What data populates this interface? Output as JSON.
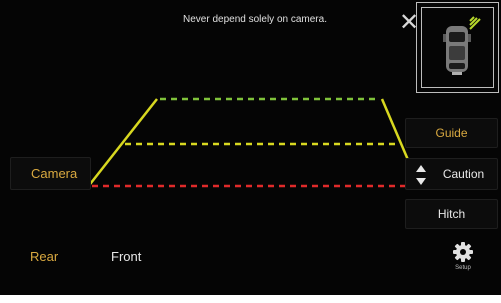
{
  "warning_text": "Never depend solely on camera.",
  "close_symbol": "✕",
  "left_buttons": {
    "camera_label": "Camera"
  },
  "right_buttons": {
    "guide_label": "Guide",
    "caution_label": "Caution",
    "hitch_label": "Hitch"
  },
  "tabs": {
    "rear_label": "Rear",
    "front_label": "Front"
  },
  "setup_label": "Setup",
  "colors": {
    "accent": "#d9a940",
    "guide_yellow": "#d8d820",
    "guide_green": "#7fc23a",
    "guide_red": "#e02a2a"
  },
  "icons": {
    "close": "close-icon",
    "updown": "up-down-arrows-icon",
    "setup": "gear-icon",
    "vehicle": "vehicle-top-view-icon"
  }
}
